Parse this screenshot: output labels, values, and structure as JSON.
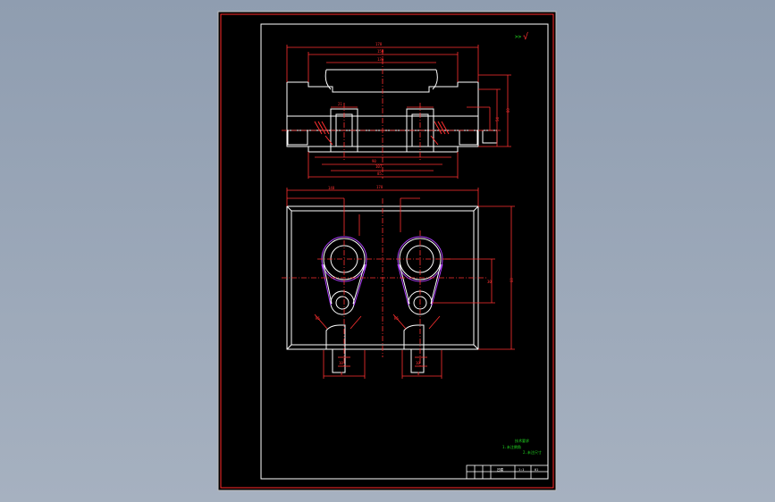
{
  "app": {
    "view": "CAD drawing viewport"
  },
  "colors": {
    "background": "#8f9db0",
    "paper": "#000000",
    "frame": "#ff2a2a",
    "outline": "#ffffff",
    "dimension": "#ff3030",
    "centerline": "#ff3030",
    "profile": "#b040ff",
    "note": "#22dd22"
  },
  "drawing": {
    "top_dims": [
      "178",
      "150",
      "130",
      "90",
      "107",
      "85",
      "21"
    ],
    "side_dims": [
      "80",
      "54",
      "30"
    ],
    "front_dims": [
      "178",
      "148",
      "60",
      "R5",
      "R5",
      "10",
      "10",
      "8",
      "8"
    ],
    "rough_symbol": "√",
    "notes": [
      "技术要求",
      "1.未注倒角",
      "2.未注尺寸"
    ],
    "title_block": {
      "name": "凹模",
      "scale": "1:1",
      "no": "01"
    }
  }
}
